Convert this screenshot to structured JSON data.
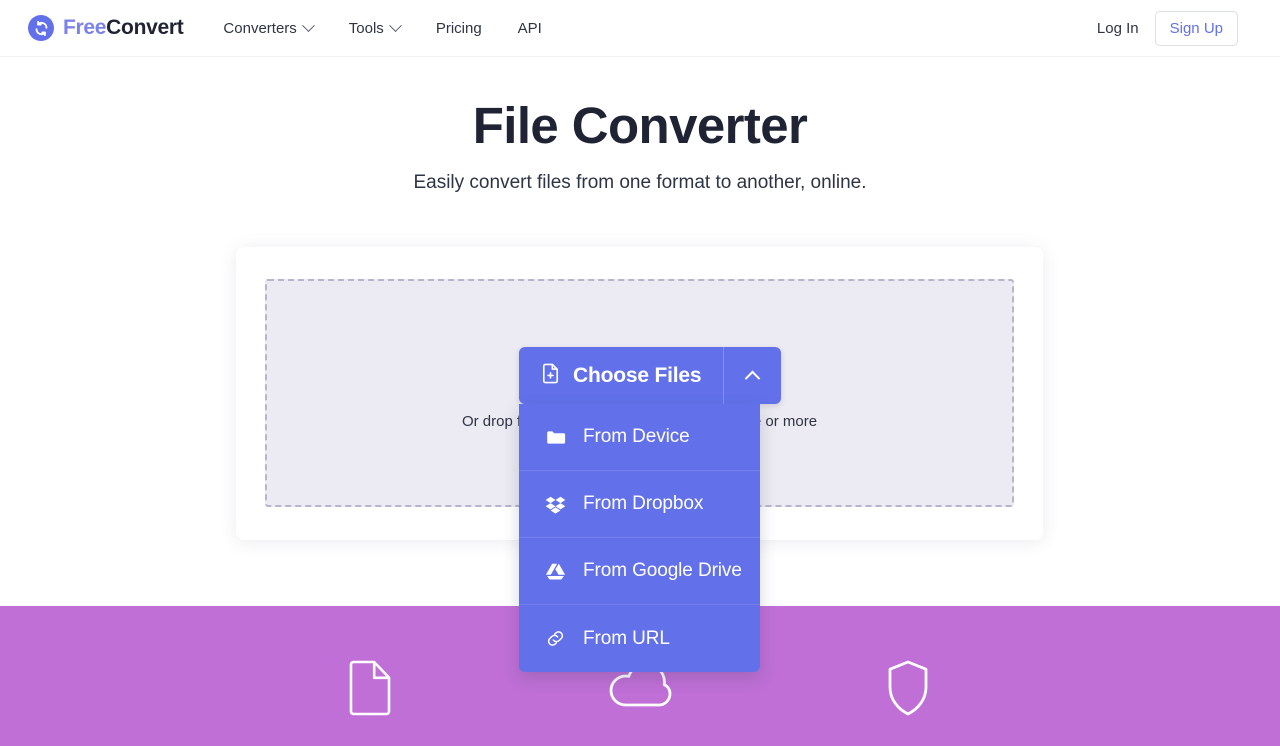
{
  "header": {
    "logo": {
      "icon": "convert-circle-icon",
      "text_primary": "Free",
      "text_secondary": "Convert"
    },
    "nav": [
      {
        "label": "Converters",
        "has_chevron": true,
        "icon": "chevron-down-icon"
      },
      {
        "label": "Tools",
        "has_chevron": true,
        "icon": "chevron-down-icon"
      },
      {
        "label": "Pricing",
        "has_chevron": false
      },
      {
        "label": "API",
        "has_chevron": false
      }
    ],
    "login_label": "Log In",
    "signup_label": "Sign Up"
  },
  "hero": {
    "title": "File Converter",
    "subtitle": "Easily convert files from one format to another, online."
  },
  "upload": {
    "choose_files_label": "Choose Files",
    "choose_files_icon": "file-plus-icon",
    "toggle_icon": "chevron-up-icon",
    "drop_hint": "Or drop files here. 100 MB maximum file size or more",
    "menu": [
      {
        "label": "From Device",
        "icon": "folder-icon"
      },
      {
        "label": "From Dropbox",
        "icon": "dropbox-icon"
      },
      {
        "label": "From Google Drive",
        "icon": "google-drive-icon"
      },
      {
        "label": "From URL",
        "icon": "link-icon"
      }
    ]
  },
  "features": [
    {
      "icon": "document-icon"
    },
    {
      "icon": "cloud-icon"
    },
    {
      "icon": "shield-icon"
    }
  ],
  "colors": {
    "brand_purple": "#6271ea",
    "logo_light": "#7b83e8",
    "band_magenta": "#bf6fd6",
    "dropzone_fill": "#eceaf2",
    "dropzone_border": "#b8b4cc",
    "text_dark": "#1f2333"
  }
}
